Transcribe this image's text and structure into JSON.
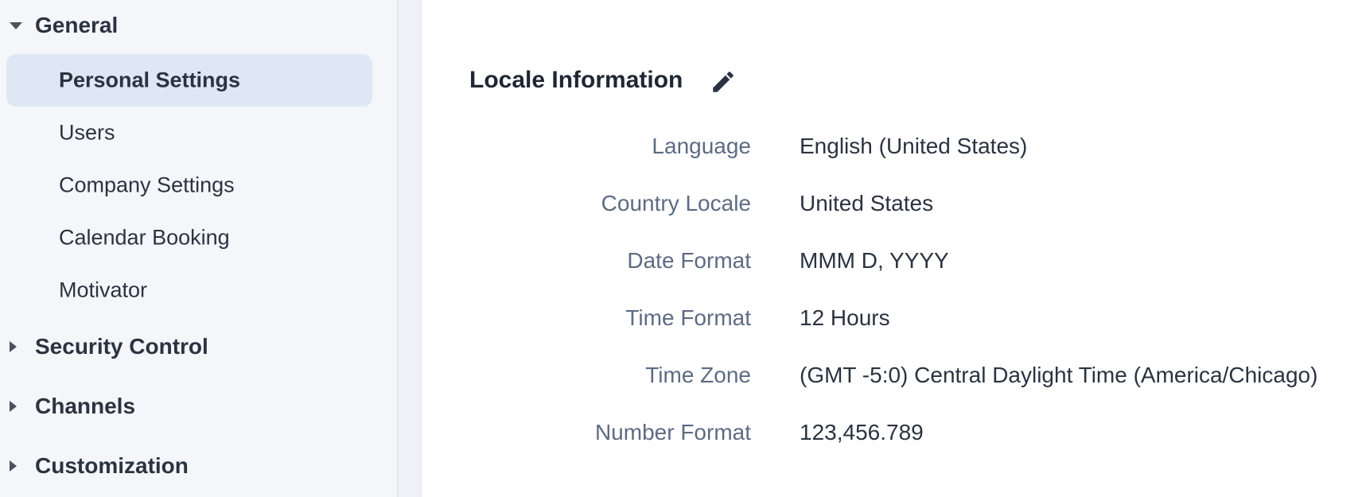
{
  "sidebar": {
    "groups": [
      {
        "label": "General",
        "expanded": true
      },
      {
        "label": "Security Control",
        "expanded": false
      },
      {
        "label": "Channels",
        "expanded": false
      },
      {
        "label": "Customization",
        "expanded": false
      }
    ],
    "general_items": [
      {
        "label": "Personal Settings",
        "active": true
      },
      {
        "label": "Users",
        "active": false
      },
      {
        "label": "Company Settings",
        "active": false
      },
      {
        "label": "Calendar Booking",
        "active": false
      },
      {
        "label": "Motivator",
        "active": false
      }
    ]
  },
  "main": {
    "section_title": "Locale Information",
    "edit_icon": "pencil-icon",
    "fields": [
      {
        "label": "Language",
        "value": "English (United States)"
      },
      {
        "label": "Country Locale",
        "value": "United States"
      },
      {
        "label": "Date Format",
        "value": "MMM D, YYYY"
      },
      {
        "label": "Time Format",
        "value": "12 Hours"
      },
      {
        "label": "Time Zone",
        "value": "(GMT -5:0) Central Daylight Time (America/Chicago)"
      },
      {
        "label": "Number Format",
        "value": "123,456.789"
      }
    ]
  },
  "colors": {
    "sidebar_bg": "#f4f6f9",
    "active_item_bg": "#dee8f4",
    "label_text": "#5d6b82",
    "value_text": "#2b3340"
  }
}
